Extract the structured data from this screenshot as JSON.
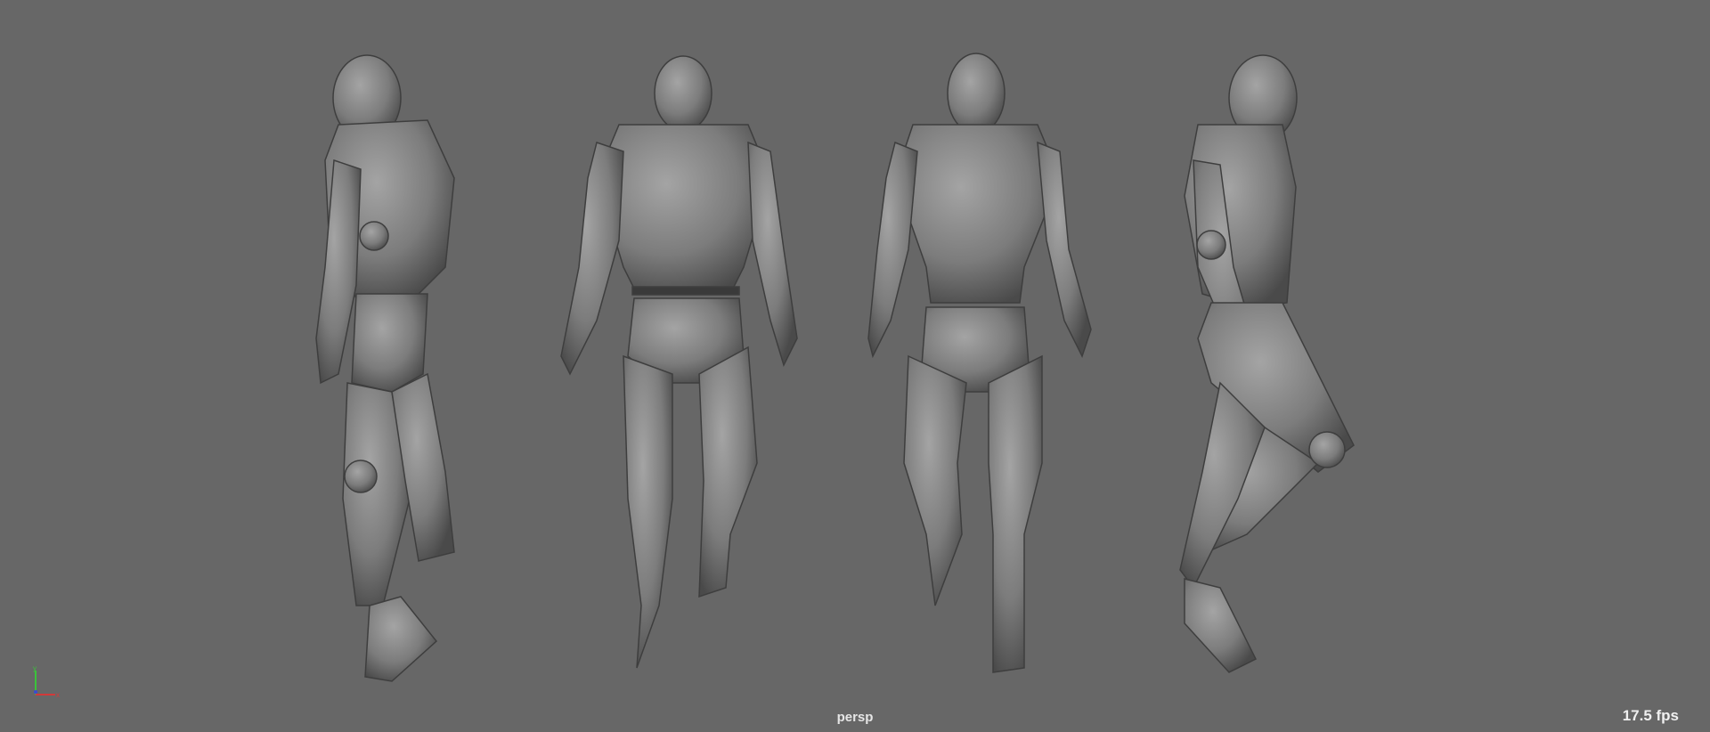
{
  "viewport": {
    "camera_label": "persp",
    "fps_label": "17.5 fps",
    "axis": {
      "y": "y",
      "x": "x"
    },
    "colors": {
      "background": "#676767",
      "model": "#8a8a8a",
      "axis_x": "#d23a3a",
      "axis_y": "#3ac43a",
      "axis_z": "#3a4ad2"
    },
    "models": [
      "side-left",
      "back",
      "front",
      "side-right"
    ]
  }
}
